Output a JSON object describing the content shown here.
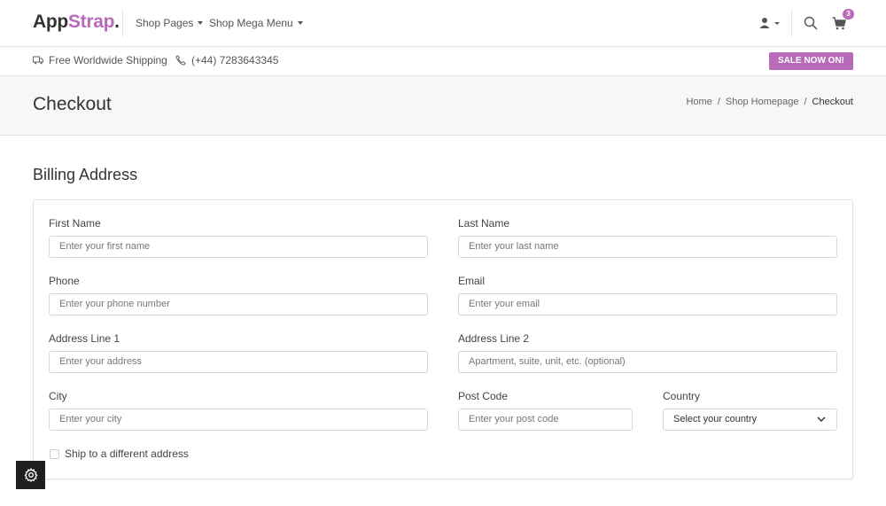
{
  "brand": {
    "name_part1": "App",
    "name_part2": "Strap",
    "name_dot": "."
  },
  "nav": {
    "shop_pages": "Shop Pages",
    "shop_mega_menu": "Shop Mega Menu",
    "cart_count": "3"
  },
  "info_bar": {
    "shipping": "Free Worldwide Shipping",
    "phone": "(+44) 7283643345",
    "sale": "SALE NOW ON!"
  },
  "page": {
    "title": "Checkout",
    "breadcrumb": [
      "Home",
      "/",
      "Shop Homepage",
      "/",
      "Checkout"
    ]
  },
  "billing": {
    "title": "Billing Address",
    "fields": {
      "first_name": {
        "label": "First Name",
        "placeholder": "Enter your first name"
      },
      "last_name": {
        "label": "Last Name",
        "placeholder": "Enter your last name"
      },
      "phone": {
        "label": "Phone",
        "placeholder": "Enter your phone number"
      },
      "email": {
        "label": "Email",
        "placeholder": "Enter your email"
      },
      "address1": {
        "label": "Address Line 1",
        "placeholder": "Enter your address"
      },
      "address2": {
        "label": "Address Line 2",
        "placeholder": "Apartment, suite, unit, etc. (optional)"
      },
      "city": {
        "label": "City",
        "placeholder": "Enter your city"
      },
      "postcode": {
        "label": "Post Code",
        "placeholder": "Enter your post code"
      },
      "country": {
        "label": "Country",
        "selected": "Select your country"
      }
    },
    "ship_different": "Ship to a different address"
  },
  "icons": {
    "user": "user-icon",
    "search": "search-icon",
    "cart": "cart-icon",
    "truck": "truck-icon",
    "phone": "phone-icon",
    "settings": "gear-icon"
  },
  "colors": {
    "accent": "#b86bb9",
    "dark": "#1f1f1f"
  }
}
